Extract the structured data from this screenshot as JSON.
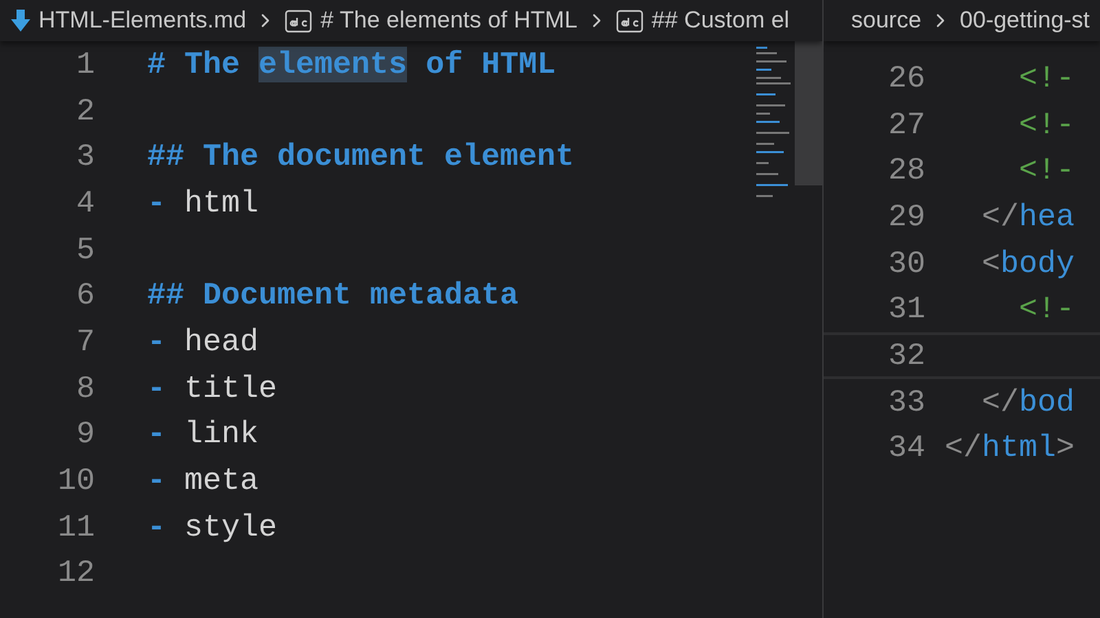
{
  "left_editor": {
    "breadcrumbs": [
      {
        "kind": "file",
        "text": "HTML-Elements.md"
      },
      {
        "kind": "symbol",
        "text": "# The elements of HTML"
      },
      {
        "kind": "symbol",
        "text": "## Custom el"
      }
    ],
    "lines": [
      {
        "number": "1",
        "tokens": [
          {
            "kind": "marker",
            "text": "#"
          },
          {
            "kind": "heading",
            "text": " The "
          },
          {
            "kind": "heading",
            "text": "elements",
            "highlighted": true
          },
          {
            "kind": "heading",
            "text": " of HTML"
          }
        ]
      },
      {
        "number": "2"
      },
      {
        "number": "3",
        "tokens": [
          {
            "kind": "marker",
            "text": "##"
          },
          {
            "kind": "heading",
            "text": " The document element"
          }
        ]
      },
      {
        "number": "4",
        "tokens": [
          {
            "kind": "marker",
            "text": "-"
          },
          {
            "kind": "text",
            "text": " html"
          }
        ]
      },
      {
        "number": "5"
      },
      {
        "number": "6",
        "tokens": [
          {
            "kind": "marker",
            "text": "##"
          },
          {
            "kind": "heading",
            "text": " Document metadata"
          }
        ]
      },
      {
        "number": "7",
        "tokens": [
          {
            "kind": "marker",
            "text": "-"
          },
          {
            "kind": "text",
            "text": " head"
          }
        ]
      },
      {
        "number": "8",
        "tokens": [
          {
            "kind": "marker",
            "text": "-"
          },
          {
            "kind": "text",
            "text": " title"
          }
        ]
      },
      {
        "number": "9",
        "tokens": [
          {
            "kind": "marker",
            "text": "-"
          },
          {
            "kind": "text",
            "text": " link"
          }
        ]
      },
      {
        "number": "10",
        "tokens": [
          {
            "kind": "marker",
            "text": "-"
          },
          {
            "kind": "text",
            "text": " meta"
          }
        ]
      },
      {
        "number": "11",
        "tokens": [
          {
            "kind": "marker",
            "text": "-"
          },
          {
            "kind": "text",
            "text": " style"
          }
        ]
      },
      {
        "number": "12"
      }
    ]
  },
  "right_editor": {
    "breadcrumbs": [
      {
        "text": "source"
      },
      {
        "text": "00-getting-st"
      }
    ],
    "lines": [
      {
        "number": "26",
        "current": false,
        "tokens": [
          {
            "kind": "comment",
            "text": "    <!-"
          }
        ]
      },
      {
        "number": "27",
        "current": false,
        "tokens": [
          {
            "kind": "comment",
            "text": "    <!-"
          }
        ]
      },
      {
        "number": "28",
        "current": false,
        "tokens": [
          {
            "kind": "comment",
            "text": "    <!-"
          }
        ]
      },
      {
        "number": "29",
        "current": false,
        "tokens": [
          {
            "kind": "punct",
            "text": "  </"
          },
          {
            "kind": "tag",
            "text": "hea"
          }
        ]
      },
      {
        "number": "30",
        "current": false,
        "tokens": [
          {
            "kind": "punct",
            "text": "  <"
          },
          {
            "kind": "tag",
            "text": "body"
          }
        ]
      },
      {
        "number": "31",
        "current": false,
        "tokens": [
          {
            "kind": "comment",
            "text": "    <!-"
          }
        ]
      },
      {
        "number": "32",
        "current": true
      },
      {
        "number": "33",
        "current": false,
        "tokens": [
          {
            "kind": "punct",
            "text": "  </"
          },
          {
            "kind": "tag",
            "text": "bod"
          }
        ]
      },
      {
        "number": "34",
        "current": false,
        "tokens": [
          {
            "kind": "punct",
            "text": "</"
          },
          {
            "kind": "tag",
            "text": "html"
          },
          {
            "kind": "punct",
            "text": ">"
          }
        ]
      }
    ]
  }
}
